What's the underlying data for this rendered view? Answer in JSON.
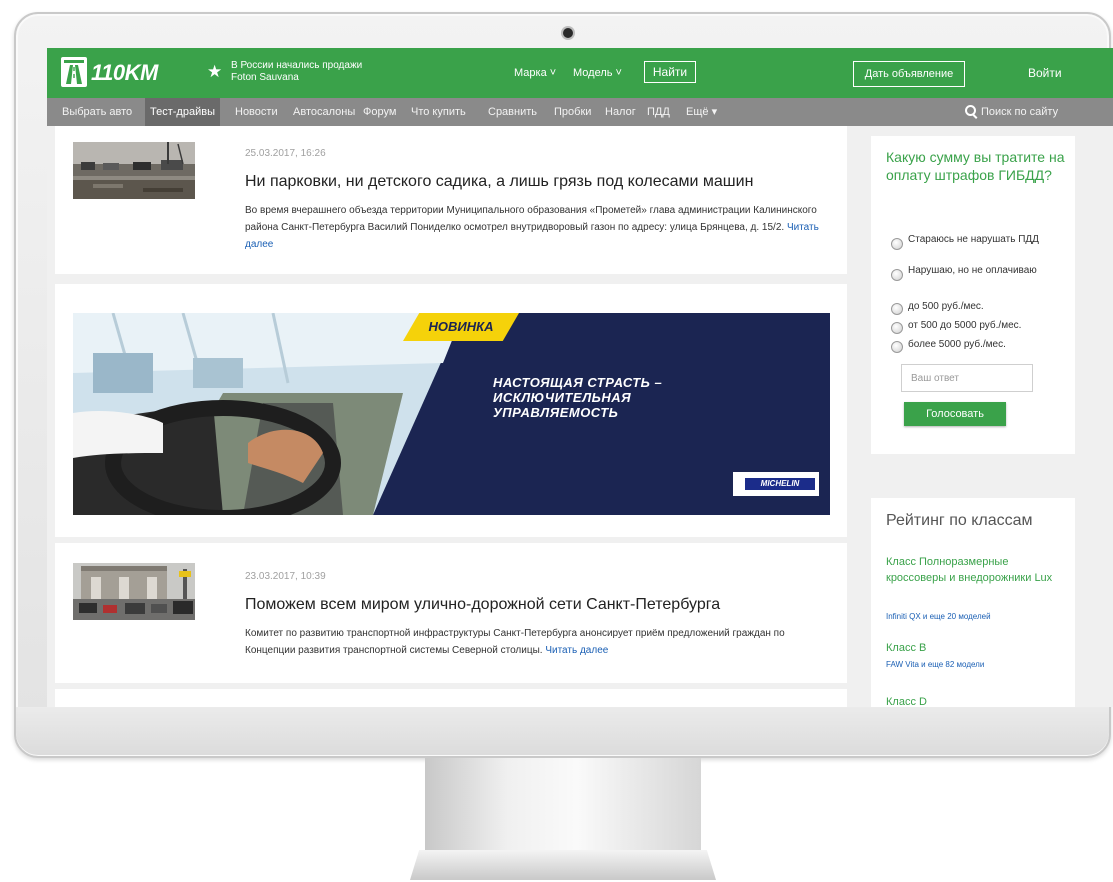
{
  "header": {
    "logo_text": "110KM",
    "promo_line1": "В России начались продажи",
    "promo_line2": "Foton Sauvana",
    "brand_select": "Марка",
    "model_select": "Модель",
    "find_button": "Найти",
    "post_ad_button": "Дать объявление",
    "login_link": "Войти"
  },
  "menu": {
    "items": [
      "Выбрать авто",
      "Тест-драйвы",
      "Новости",
      "Автосалоны",
      "Форум",
      "Что купить",
      "Сравнить",
      "Пробки",
      "Налог",
      "ПДД",
      "Ещё"
    ],
    "active_index": 1,
    "search_label": "Поиск по сайту"
  },
  "news": [
    {
      "date": "25.03.2017, 16:26",
      "title": "Ни парковки, ни детского садика, а лишь грязь под колесами машин",
      "text": "Во время вчерашнего объезда территории Муниципального образования «Прометей» глава администрации Калининского района Санкт-Петербурга Василий Пониделко осмотрел внутридворовый газон по адресу: улица Брянцева, д. 15/2.",
      "read_more": "Читать далее"
    },
    {
      "date": "23.03.2017, 10:39",
      "title": "Поможем всем миром улично-дорожной сети Санкт-Петербурга",
      "text": "Комитет по развитию транспортной инфраструктуры Санкт-Петербурга анонсирует приём предложений граждан по Концепции развития транспортной системы Северной столицы.",
      "read_more": "Читать далее"
    }
  ],
  "banner": {
    "badge": "НОВИНКА",
    "slogan_line1": "НАСТОЯЩАЯ СТРАСТЬ –",
    "slogan_line2": "ИСКЛЮЧИТЕЛЬНАЯ",
    "slogan_line3": "УПРАВЛЯЕМОСТЬ",
    "brand": "MICHELIN"
  },
  "poll": {
    "question": "Какую сумму вы тратите на оплату штрафов ГИБДД?",
    "options": [
      "Стараюсь не нарушать ПДД",
      "Нарушаю, но не оплачиваю",
      "до 500 руб./мес.",
      "от 500 до 5000 руб./мес.",
      "более 5000 руб./мес."
    ],
    "answer_placeholder": "Ваш ответ",
    "vote_button": "Голосовать"
  },
  "rating": {
    "title": "Рейтинг по классам",
    "classes": [
      {
        "name": "Класс Полноразмерные кроссоверы и внедорожники Lux",
        "sub": "Infiniti QX и еще 20 моделей"
      },
      {
        "name": "Класс B",
        "sub": "FAW Vita и еще 82 модели"
      },
      {
        "name": "Класс D",
        "sub": ""
      }
    ]
  },
  "colors": {
    "brand_green": "#3aa24a",
    "menu_gray": "#8a8a8a",
    "banner_navy": "#1b2552",
    "badge_yellow": "#f5d20a",
    "link_blue": "#1a5fb4"
  }
}
